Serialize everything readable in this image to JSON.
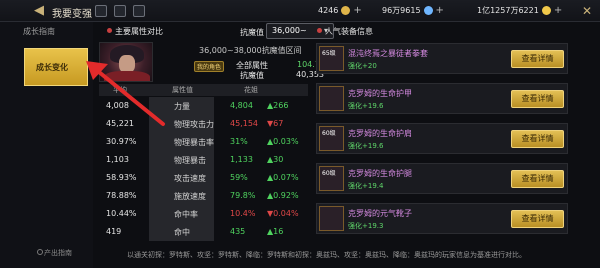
{
  "header": {
    "title": "我要变强",
    "resources": [
      {
        "value": "4246",
        "color": "#e0b54a"
      },
      {
        "value": "96万9615",
        "color": "#6fb6ff"
      },
      {
        "value": "1亿1257万6221",
        "color": "#f0c84a"
      }
    ]
  },
  "left_tabs": [
    {
      "label": "成长指南"
    },
    {
      "label": "成长变化"
    }
  ],
  "output_guide": "产出指南",
  "attr": {
    "section_title": "主要属性对比",
    "ability_label": "抗魔值",
    "ability_select": "36,000~",
    "range_text": "36,000~38,000抗魔值区间",
    "my_char_tag": "我的角色",
    "total_label": "全部属性",
    "total_value": "104.7%",
    "ability_value_label": "抗魔值",
    "ability_value": "40,353",
    "table_headers": [
      "平均",
      "属性值",
      "花姐"
    ],
    "rows": [
      {
        "avg": "4,008",
        "name": "力量",
        "mine": "4,804",
        "diff": "▲266",
        "mine_color": "g",
        "diff_color": "g"
      },
      {
        "avg": "45,221",
        "name": "物理攻击力",
        "mine": "45,154",
        "diff": "▼67",
        "mine_color": "r",
        "diff_color": "r"
      },
      {
        "avg": "30.97%",
        "name": "物理暴击率",
        "mine": "31%",
        "diff": "▲0.03%",
        "mine_color": "g",
        "diff_color": "g"
      },
      {
        "avg": "1,103",
        "name": "物理暴击",
        "mine": "1,133",
        "diff": "▲30",
        "mine_color": "g",
        "diff_color": "g"
      },
      {
        "avg": "58.93%",
        "name": "攻击速度",
        "mine": "59%",
        "diff": "▲0.07%",
        "mine_color": "g",
        "diff_color": "g"
      },
      {
        "avg": "78.88%",
        "name": "施放速度",
        "mine": "79.8%",
        "diff": "▲0.92%",
        "mine_color": "g",
        "diff_color": "g"
      },
      {
        "avg": "10.44%",
        "name": "命中率",
        "mine": "10.4%",
        "diff": "▼0.04%",
        "mine_color": "r",
        "diff_color": "r"
      },
      {
        "avg": "419",
        "name": "命中",
        "mine": "435",
        "diff": "▲16",
        "mine_color": "g",
        "diff_color": "g"
      }
    ]
  },
  "equip": {
    "section_title": "人气装备信息",
    "button_label": "查看详情",
    "items": [
      {
        "level": "65级",
        "name": "混沌终焉之暴徒者拳套",
        "enh": "强化+20"
      },
      {
        "level": "",
        "name": "克罗姆的生命护甲",
        "enh": "强化+19.6"
      },
      {
        "level": "60级",
        "name": "克罗姆的生命护肩",
        "enh": "强化+19.6"
      },
      {
        "level": "60级",
        "name": "克罗姆的生命护腿",
        "enh": "强化+19.4"
      },
      {
        "level": "",
        "name": "克罗姆的元气靴子",
        "enh": "强化+19.3"
      }
    ]
  },
  "footer": "以通关初探：罗特斯、攻坚：罗特斯、降临：罗特斯和初探：奥兹玛、攻坚：奥兹玛、降临：奥兹玛的玩家信息为基准进行对比。"
}
